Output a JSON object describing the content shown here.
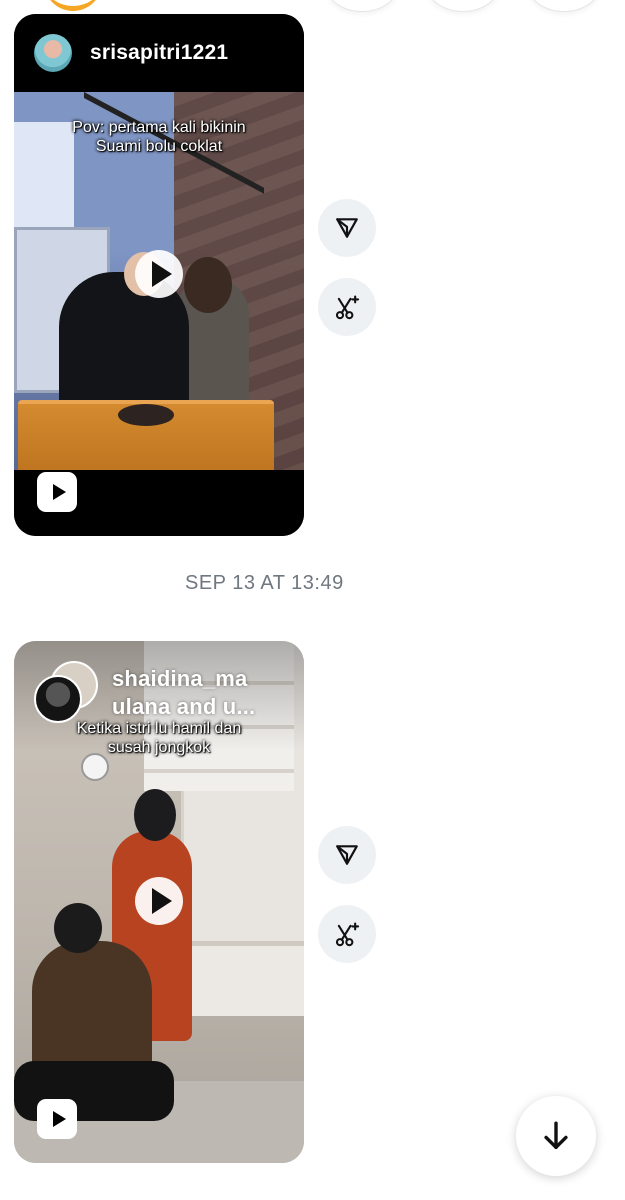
{
  "thread": {
    "timestamp": "SEP 13 AT 13:49",
    "scroll_down_icon": "arrow-down-icon"
  },
  "reels": [
    {
      "username": "srisapitri1221",
      "caption": "Pov: pertama kali bikinin\nSuami bolu coklat",
      "share_icon": "share-paper-plane-icon",
      "remix_icon": "sparkle-scissors-icon"
    },
    {
      "username": "shaidina_ma\nulana and u...",
      "caption": "Ketika istri lu hamil dan\nsusah jongkok",
      "share_icon": "share-paper-plane-icon",
      "remix_icon": "sparkle-scissors-icon"
    }
  ],
  "colors": {
    "action_button_bg": "#eef1f4",
    "timestamp_text": "#6f7780",
    "story_ring": "#f6a623"
  }
}
